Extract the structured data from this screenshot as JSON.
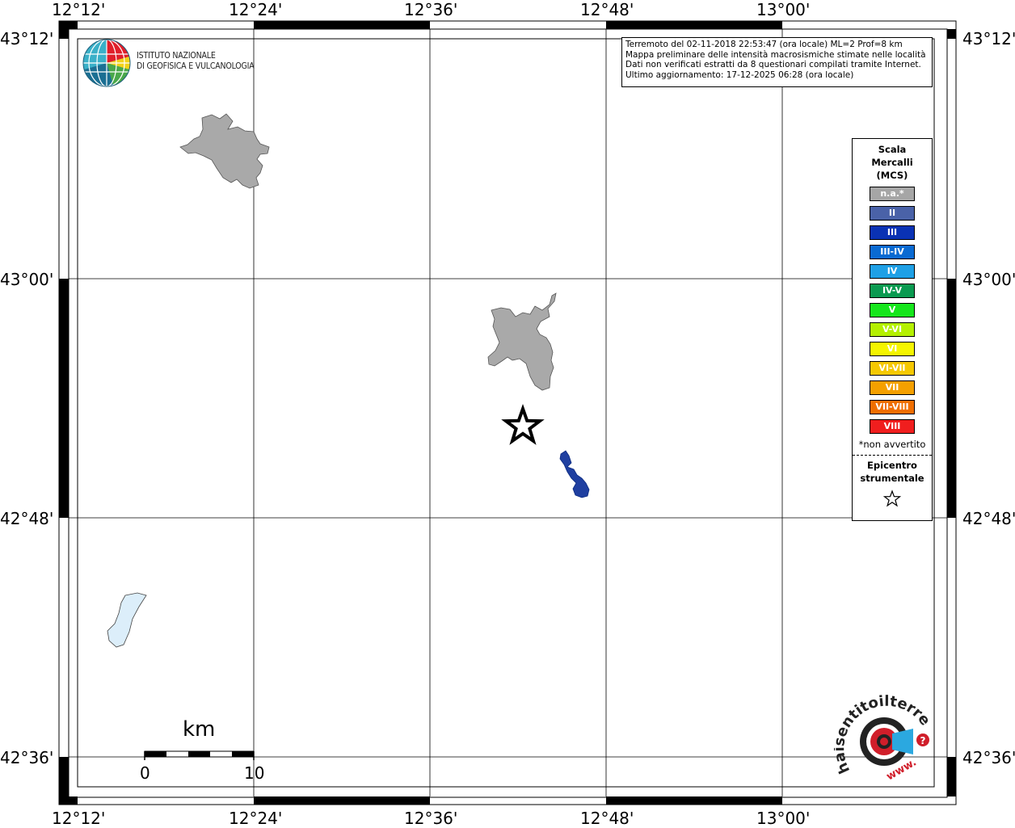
{
  "map": {
    "top_labels": [
      "12°12'",
      "12°24'",
      "12°36'",
      "12°48'",
      "13°00'"
    ],
    "bottom_labels": [
      "12°12'",
      "12°24'",
      "12°36'",
      "12°48'",
      "13°00'"
    ],
    "left_labels": [
      "43°12'",
      "43°00'",
      "42°48'",
      "42°36'"
    ],
    "right_labels": [
      "43°12'",
      "43°00'",
      "42°48'",
      "42°36'"
    ],
    "colors": {
      "gray_area": "#a9a9a9",
      "blue_area": "#1f3fa0",
      "lake": "#dceefa"
    }
  },
  "logo_ingv": {
    "line1": "ISTITUTO NAZIONALE",
    "line2": "DI GEOFISICA E VULCANOLOGIA"
  },
  "info": {
    "line1": "Terremoto del 02-11-2018 22:53:47 (ora locale) ML=2 Prof=8 km",
    "line2": "Mappa preliminare delle intensità macrosismiche stimate nelle località",
    "line3": "Dati non verificati estratti da 8 questionari compilati tramite Internet.",
    "line4": "Ultimo aggiornamento: 17-12-2025 06:28 (ora locale)"
  },
  "legend": {
    "title_line1": "Scala",
    "title_line2": "Mercalli",
    "title_line3": "(MCS)",
    "items": [
      {
        "label": "n.a.*",
        "color": "#a6a6a6"
      },
      {
        "label": "II",
        "color": "#4a62a8"
      },
      {
        "label": "III",
        "color": "#0a32b4"
      },
      {
        "label": "III-IV",
        "color": "#0a6ad2"
      },
      {
        "label": "IV",
        "color": "#1ea0e6"
      },
      {
        "label": "IV-V",
        "color": "#0a9a50"
      },
      {
        "label": "V",
        "color": "#16e61c"
      },
      {
        "label": "V-VI",
        "color": "#b4f000"
      },
      {
        "label": "VI",
        "color": "#f5f500"
      },
      {
        "label": "VI-VII",
        "color": "#f5c800"
      },
      {
        "label": "VII",
        "color": "#f5a000"
      },
      {
        "label": "VII-VIII",
        "color": "#f06e00"
      },
      {
        "label": "VIII",
        "color": "#f01e1e"
      }
    ],
    "note": "*non avvertito",
    "epicentro_line1": "Epicentro",
    "epicentro_line2": "strumentale"
  },
  "scale_bar": {
    "unit": "km",
    "start": "0",
    "end": "10"
  },
  "hsit_logo": {
    "text_arc": "haisentitoilterremoto.it",
    "text_www": "www."
  }
}
